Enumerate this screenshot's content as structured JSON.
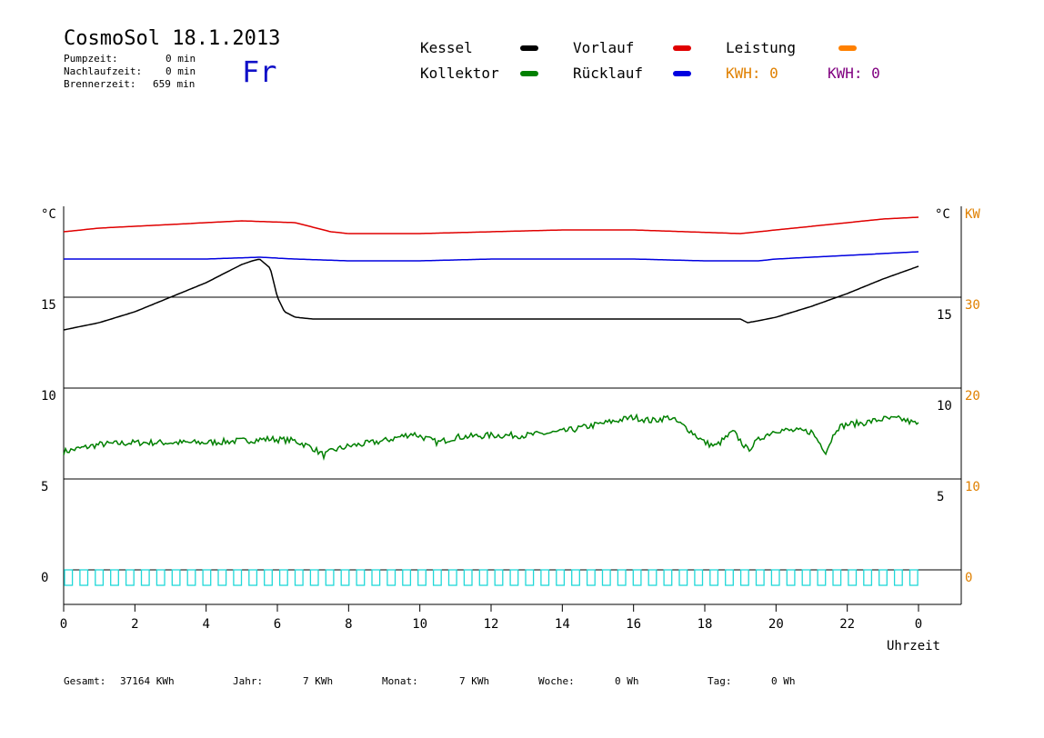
{
  "header": {
    "title": "CosmoSol 18.1.2013",
    "day": "Fr",
    "pumpzeit_label": "Pumpzeit:",
    "pumpzeit_value": "0 min",
    "nachlaufzeit_label": "Nachlaufzeit:",
    "nachlaufzeit_value": "0 min",
    "brennerzeit_label": "Brennerzeit:",
    "brennerzeit_value": "659 min"
  },
  "legend": {
    "kessel": "Kessel",
    "kollektor": "Kollektor",
    "vorlauf": "Vorlauf",
    "ruecklauf": "Rücklauf",
    "leistung": "Leistung",
    "kwh1": "KWH: 0",
    "kwh2": "KWH: 0"
  },
  "colors": {
    "kessel": "#000000",
    "kollektor": "#008000",
    "vorlauf": "#e00000",
    "ruecklauf": "#0000e0",
    "leistung": "#ff8000",
    "kwh1": "#e08000",
    "kwh2": "#800080",
    "pump": "#20d8d8",
    "day": "#1010c8"
  },
  "footer": {
    "gesamt_label": "Gesamt:",
    "gesamt_value": "37164 KWh",
    "jahr_label": "Jahr:",
    "jahr_value": "7 KWh",
    "monat_label": "Monat:",
    "monat_value": "7 KWh",
    "woche_label": "Woche:",
    "woche_value": "0 Wh",
    "tag_label": "Tag:",
    "tag_value": "0 Wh"
  },
  "chart_data": {
    "type": "line",
    "xlabel": "Uhrzeit",
    "x_ticks": [
      "0",
      "2",
      "4",
      "6",
      "8",
      "10",
      "12",
      "14",
      "16",
      "18",
      "20",
      "22",
      "0"
    ],
    "x_range": [
      0,
      24
    ],
    "y_left_unit": "°C",
    "y_left_ticks": [
      "0",
      "5",
      "10",
      "15"
    ],
    "y_left_range": [
      0,
      20
    ],
    "y_mid_ticks": [
      "5",
      "10",
      "15"
    ],
    "y_right_unit": "KW",
    "y_right_ticks": [
      "0",
      "10",
      "20",
      "30"
    ],
    "y_right_range": [
      0,
      40
    ],
    "grid": "horizontal",
    "series": [
      {
        "name": "Vorlauf",
        "color": "#e00000",
        "x": [
          0,
          1,
          2,
          3,
          4,
          5,
          6.5,
          7.5,
          8,
          10,
          12,
          14,
          16,
          17.5,
          19,
          20,
          21,
          22,
          23,
          24
        ],
        "y": [
          18.6,
          18.8,
          18.9,
          19.0,
          19.1,
          19.2,
          19.1,
          18.6,
          18.5,
          18.5,
          18.6,
          18.7,
          18.7,
          18.6,
          18.5,
          18.7,
          18.9,
          19.1,
          19.3,
          19.4
        ]
      },
      {
        "name": "Rücklauf",
        "color": "#0000e0",
        "x": [
          0,
          2,
          4,
          5.5,
          6.5,
          8,
          10,
          12,
          14,
          16,
          18,
          19.5,
          20,
          21,
          22,
          23,
          24
        ],
        "y": [
          17.1,
          17.1,
          17.1,
          17.2,
          17.1,
          17.0,
          17.0,
          17.1,
          17.1,
          17.1,
          17.0,
          17.0,
          17.1,
          17.2,
          17.3,
          17.4,
          17.5
        ]
      },
      {
        "name": "Kessel",
        "color": "#000000",
        "x": [
          0,
          0.5,
          1,
          1.5,
          2,
          2.5,
          3,
          3.5,
          4,
          4.5,
          5,
          5.3,
          5.5,
          5.8,
          6.0,
          6.2,
          6.5,
          7,
          8,
          10,
          12,
          14,
          16,
          17,
          18,
          19,
          19.2,
          19.5,
          20,
          21,
          22,
          23,
          24
        ],
        "y": [
          13.2,
          13.4,
          13.6,
          13.9,
          14.2,
          14.6,
          15.0,
          15.4,
          15.8,
          16.3,
          16.8,
          17.0,
          17.1,
          16.6,
          15.0,
          14.2,
          13.9,
          13.8,
          13.8,
          13.8,
          13.8,
          13.8,
          13.8,
          13.8,
          13.8,
          13.8,
          13.6,
          13.7,
          13.9,
          14.5,
          15.2,
          16.0,
          16.7
        ]
      },
      {
        "name": "Kollektor",
        "color": "#008000",
        "x": [
          0,
          0.5,
          1,
          2,
          3,
          4,
          5,
          5.8,
          6.5,
          7,
          7.3,
          7.6,
          8,
          9,
          9.8,
          10.5,
          11,
          12,
          13,
          14,
          15,
          16,
          16.5,
          17,
          17.5,
          18,
          18.3,
          18.8,
          19.2,
          19.6,
          20,
          21,
          21.4,
          21.7,
          22,
          22.5,
          23,
          23.5,
          24
        ],
        "y": [
          6.5,
          6.7,
          6.9,
          7.0,
          7.0,
          7.0,
          7.1,
          7.2,
          7.1,
          6.7,
          6.3,
          6.6,
          6.8,
          7.1,
          7.5,
          7.0,
          7.3,
          7.4,
          7.4,
          7.6,
          8.0,
          8.4,
          8.2,
          8.4,
          7.8,
          7.0,
          6.8,
          7.6,
          6.6,
          7.3,
          7.7,
          7.6,
          6.5,
          7.8,
          8.0,
          8.1,
          8.3,
          8.3,
          8.0
        ]
      }
    ],
    "pump_pulses": "periodic 0/1 cycling across the day"
  }
}
